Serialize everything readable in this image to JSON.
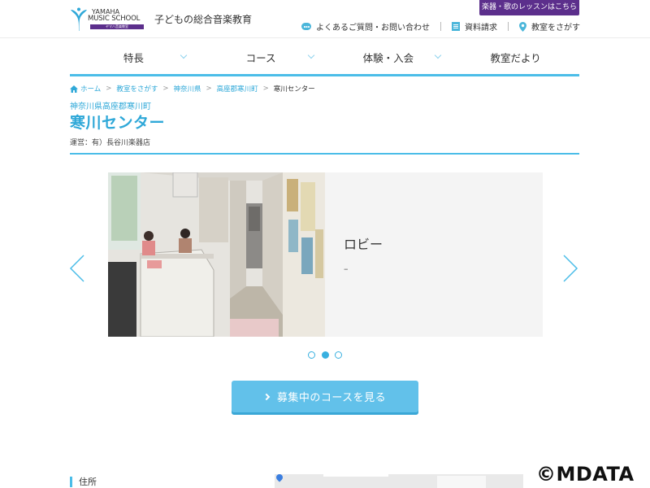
{
  "header": {
    "logo": {
      "line1": "YAMAHA",
      "line2": "MUSIC SCHOOL",
      "band": "ヤマハ音楽教室"
    },
    "tagline": "子どもの総合音楽教育",
    "lesson_button": "楽器・歌のレッスンはこちら",
    "util_links": [
      {
        "label": "よくあるご質問・お問い合わせ",
        "icon": "chat-icon"
      },
      {
        "label": "資料請求",
        "icon": "document-icon"
      },
      {
        "label": "教室をさがす",
        "icon": "map-pin-icon"
      }
    ]
  },
  "nav": {
    "items": [
      {
        "label": "特長",
        "has_dropdown": true
      },
      {
        "label": "コース",
        "has_dropdown": true
      },
      {
        "label": "体験・入会",
        "has_dropdown": true
      },
      {
        "label": "教室だより",
        "has_dropdown": false
      }
    ]
  },
  "breadcrumb": {
    "items": [
      "ホーム",
      "教室をさがす",
      "神奈川県",
      "高座郡寒川町"
    ],
    "current": "寒川センター"
  },
  "page": {
    "location": "神奈川県高座郡寒川町",
    "title": "寒川センター",
    "operator": "運営：有）長谷川楽器店"
  },
  "slider": {
    "caption": "ロビー",
    "subcaption": "–",
    "dot_count": 3,
    "active_index": 1
  },
  "cta": {
    "label": "募集中のコースを見る"
  },
  "section": {
    "address_heading": "住所"
  },
  "watermark": "©MDATA",
  "colors": {
    "accent": "#4bbde8",
    "link": "#2fa8d8",
    "purple": "#5c2f8c",
    "cta": "#62c1ea"
  }
}
